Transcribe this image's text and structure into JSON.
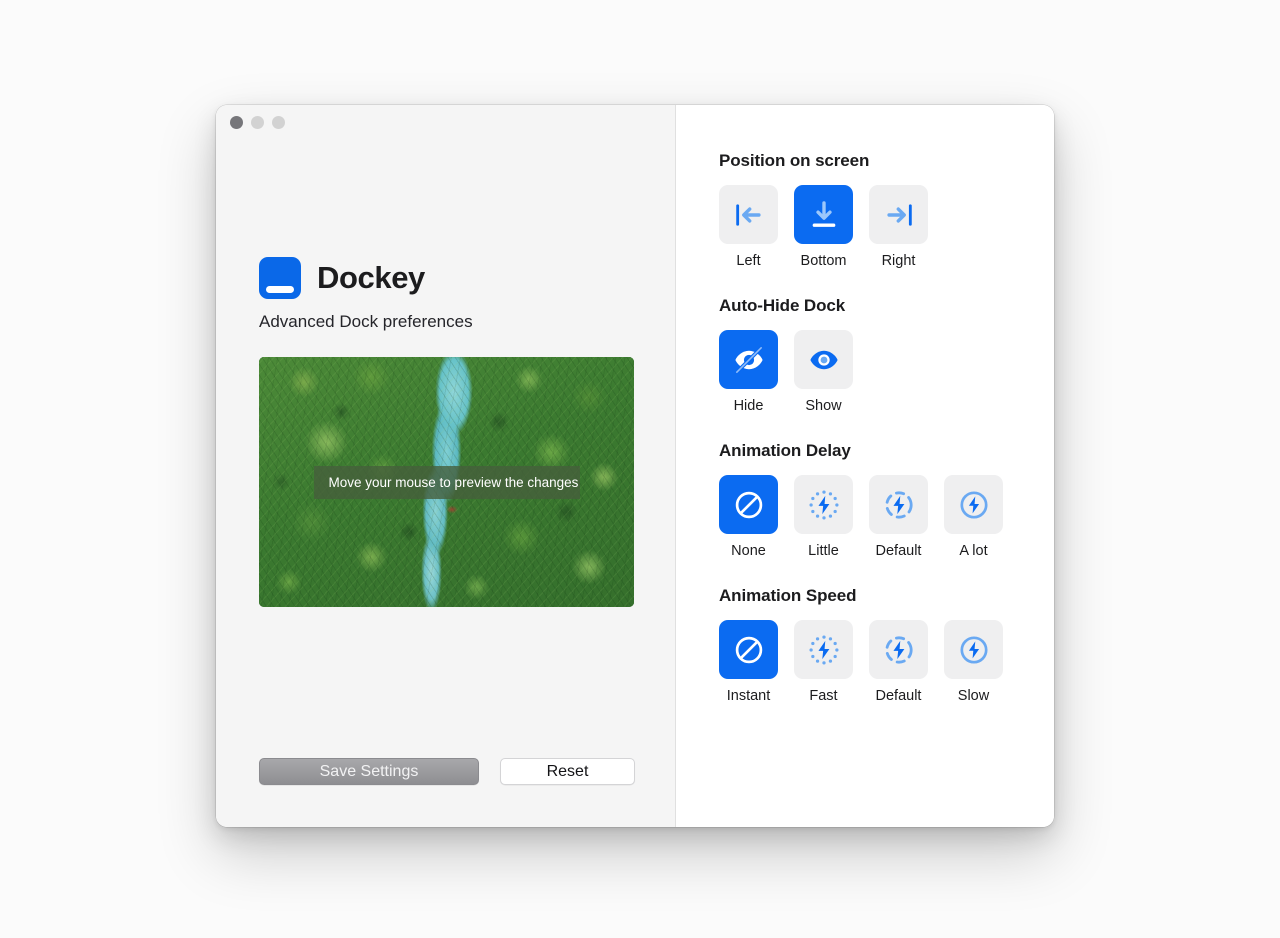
{
  "window": {
    "traffic_lights": [
      "close",
      "minimize",
      "maximize"
    ]
  },
  "brand": {
    "app_name": "Dockey",
    "subtitle": "Advanced Dock preferences",
    "icon": "dock-app-icon",
    "accent_color": "#0b6bf1"
  },
  "preview": {
    "name": "preview-image",
    "overlay_text": "Move your mouse to preview the changes"
  },
  "actions": {
    "save_label": "Save Settings",
    "reset_label": "Reset"
  },
  "sections": [
    {
      "title": "Position on screen",
      "name": "position-on-screen",
      "options": [
        {
          "label": "Left",
          "icon": "arrow-left-to-bar-icon",
          "selected": false
        },
        {
          "label": "Bottom",
          "icon": "arrow-down-to-bar-icon",
          "selected": true
        },
        {
          "label": "Right",
          "icon": "arrow-right-to-bar-icon",
          "selected": false
        }
      ]
    },
    {
      "title": "Auto-Hide Dock",
      "name": "auto-hide-dock",
      "options": [
        {
          "label": "Hide",
          "icon": "eye-off-icon",
          "selected": true
        },
        {
          "label": "Show",
          "icon": "eye-icon",
          "selected": false
        }
      ]
    },
    {
      "title": "Animation Delay",
      "name": "animation-delay",
      "options": [
        {
          "label": "None",
          "icon": "prohibited-icon",
          "selected": true
        },
        {
          "label": "Little",
          "icon": "bolt-dotted-icon",
          "selected": false
        },
        {
          "label": "Default",
          "icon": "bolt-dashed-icon",
          "selected": false
        },
        {
          "label": "A lot",
          "icon": "bolt-solid-ring-icon",
          "selected": false
        }
      ]
    },
    {
      "title": "Animation Speed",
      "name": "animation-speed",
      "options": [
        {
          "label": "Instant",
          "icon": "prohibited-icon",
          "selected": true
        },
        {
          "label": "Fast",
          "icon": "bolt-dotted-icon",
          "selected": false
        },
        {
          "label": "Default",
          "icon": "bolt-dashed-icon",
          "selected": false
        },
        {
          "label": "Slow",
          "icon": "bolt-solid-ring-icon",
          "selected": false
        }
      ]
    }
  ]
}
